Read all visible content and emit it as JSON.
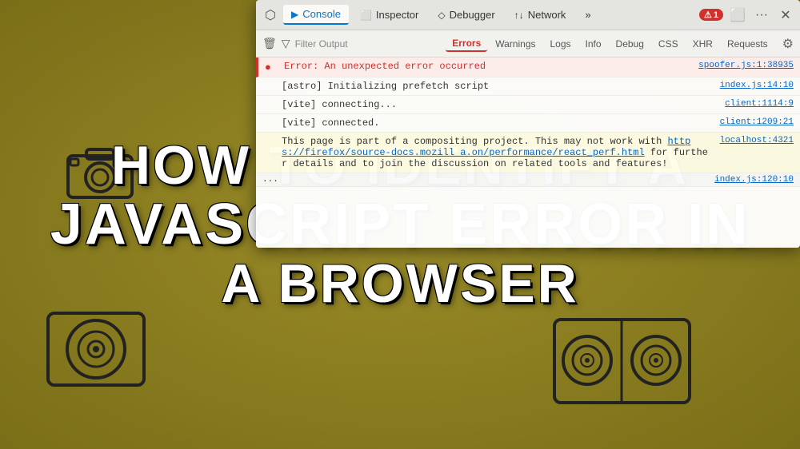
{
  "background_color": "#8B7D1A",
  "title": {
    "line1": "HOW TO IDENTIFY A",
    "line2": "JAVASCRIPT ERROR IN",
    "line3": "A BROWSER"
  },
  "devtools": {
    "tabs": [
      {
        "id": "console",
        "label": "Console",
        "icon": "▶",
        "active": true
      },
      {
        "id": "inspector",
        "label": "Inspector",
        "icon": "⬜",
        "active": false
      },
      {
        "id": "debugger",
        "label": "Debugger",
        "icon": "◇",
        "active": false
      },
      {
        "id": "network",
        "label": "Network",
        "icon": "↑↓",
        "active": false
      },
      {
        "id": "more",
        "label": "»",
        "icon": "",
        "active": false
      }
    ],
    "error_badge": "1",
    "filter_placeholder": "Filter Output",
    "filter_tabs": [
      "Errors",
      "Warnings",
      "Logs",
      "Info",
      "Debug",
      "CSS",
      "XHR",
      "Requests"
    ],
    "console_rows": [
      {
        "type": "error",
        "icon": "●",
        "text": "Error: An unexpected error occurred",
        "source": "spoofer.js:1:38935"
      },
      {
        "type": "log",
        "icon": "",
        "text": "[astro] Initializing prefetch script",
        "source": "index.js:14:10"
      },
      {
        "type": "log",
        "icon": "",
        "text": "[vite] connecting...",
        "source": "client:1114:9"
      },
      {
        "type": "log",
        "icon": "",
        "text": "[vite] connected.",
        "source": "client:1209:21"
      },
      {
        "type": "info",
        "icon": "",
        "text": "This page is part of a compositing project. This may not work with https://firefox/source-docs.mozill a.on/performance/react_perf.html for further details and to join the discussion on related tools and features!",
        "source": "localhost:4321"
      },
      {
        "type": "log",
        "icon": "",
        "text": "...",
        "source": "index.js:120:10"
      }
    ]
  }
}
